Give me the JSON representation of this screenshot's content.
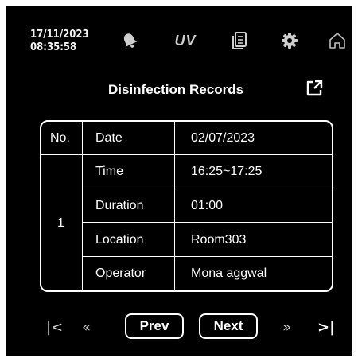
{
  "header": {
    "date": "17/11/2023",
    "time": "08:35:58",
    "icons": [
      "bell-icon",
      "uv-text-icon",
      "records-icon",
      "gear-icon",
      "home-icon"
    ],
    "uv_label": "UV"
  },
  "title": "Disinfection Records",
  "table": {
    "no_header": "No.",
    "record_no": "1",
    "rows": [
      {
        "label": "Date",
        "value": "02/07/2023"
      },
      {
        "label": "Time",
        "value": "16:25~17:25"
      },
      {
        "label": "Duration",
        "value": "01:00"
      },
      {
        "label": "Location",
        "value": "Room303"
      },
      {
        "label": "Operator",
        "value": "Mona aggwal"
      }
    ]
  },
  "pagination": {
    "first": "|<",
    "prev_fast": "«",
    "prev_label": "Prev",
    "next_label": "Next",
    "next_fast": "»",
    "last": ">|"
  },
  "colors": {
    "background": "#000000",
    "text": "#ffffff",
    "icon": "#cfcfcf"
  }
}
